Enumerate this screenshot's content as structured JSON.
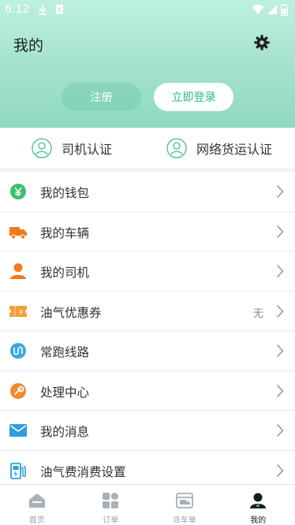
{
  "status_bar": {
    "time": "6:12"
  },
  "header": {
    "title": "我的",
    "settings_icon": "gear-icon",
    "register_label": "注册",
    "login_label": "立即登录"
  },
  "certifications": [
    {
      "label": "司机认证",
      "icon": "user-outline-icon"
    },
    {
      "label": "网络货运认证",
      "icon": "user-outline-icon"
    }
  ],
  "menu": [
    {
      "label": "我的钱包",
      "icon": "wallet-icon",
      "value": ""
    },
    {
      "label": "我的车辆",
      "icon": "truck-icon",
      "value": ""
    },
    {
      "label": "我的司机",
      "icon": "driver-icon",
      "value": ""
    },
    {
      "label": "油气优惠券",
      "icon": "coupon-icon",
      "value": "无"
    },
    {
      "label": "常跑线路",
      "icon": "route-icon",
      "value": ""
    },
    {
      "label": "处理中心",
      "icon": "wrench-icon",
      "value": ""
    },
    {
      "label": "我的消息",
      "icon": "mail-icon",
      "value": ""
    },
    {
      "label": "油气费消费设置",
      "icon": "fuel-pump-icon",
      "value": ""
    }
  ],
  "bottom_nav": [
    {
      "label": "首页",
      "icon": "home-icon",
      "active": false
    },
    {
      "label": "订单",
      "icon": "grid-icon",
      "active": false
    },
    {
      "label": "派车单",
      "icon": "dispatch-icon",
      "active": false
    },
    {
      "label": "我的",
      "icon": "profile-icon",
      "active": true
    }
  ],
  "colors": {
    "accent": "#2bb591",
    "header_gradient_top": "#bdf0df",
    "header_gradient_bottom": "#8fd8bf"
  }
}
